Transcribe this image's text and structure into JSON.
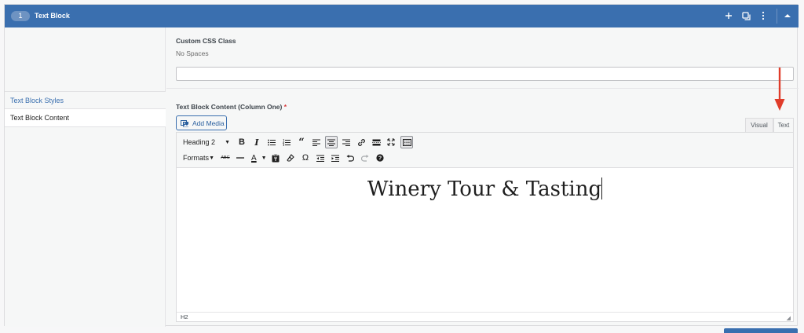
{
  "header": {
    "badge": "1",
    "title": "Text Block",
    "icons": [
      "plus-icon",
      "duplicate-icon",
      "more-vertical-icon",
      "collapse-icon"
    ]
  },
  "sidebar": {
    "items": [
      {
        "label": "Text Block Styles",
        "active": false
      },
      {
        "label": "Text Block Content",
        "active": true
      }
    ]
  },
  "fields": {
    "css_label": "Custom CSS Class",
    "css_hint": "No Spaces",
    "css_value": "",
    "content_label": "Text Block Content (Column One)",
    "required_mark": "*"
  },
  "editor": {
    "add_media_label": "Add Media",
    "tabs": {
      "visual": "Visual",
      "text": "Text"
    },
    "format_select": "Heading 2",
    "formats_menu": "Formats",
    "content_text": "Winery Tour & Tasting",
    "status_path": "H2"
  },
  "colors": {
    "header_bg": "#3a6faf",
    "link": "#3a6faf",
    "arrow": "#e03c2a"
  }
}
